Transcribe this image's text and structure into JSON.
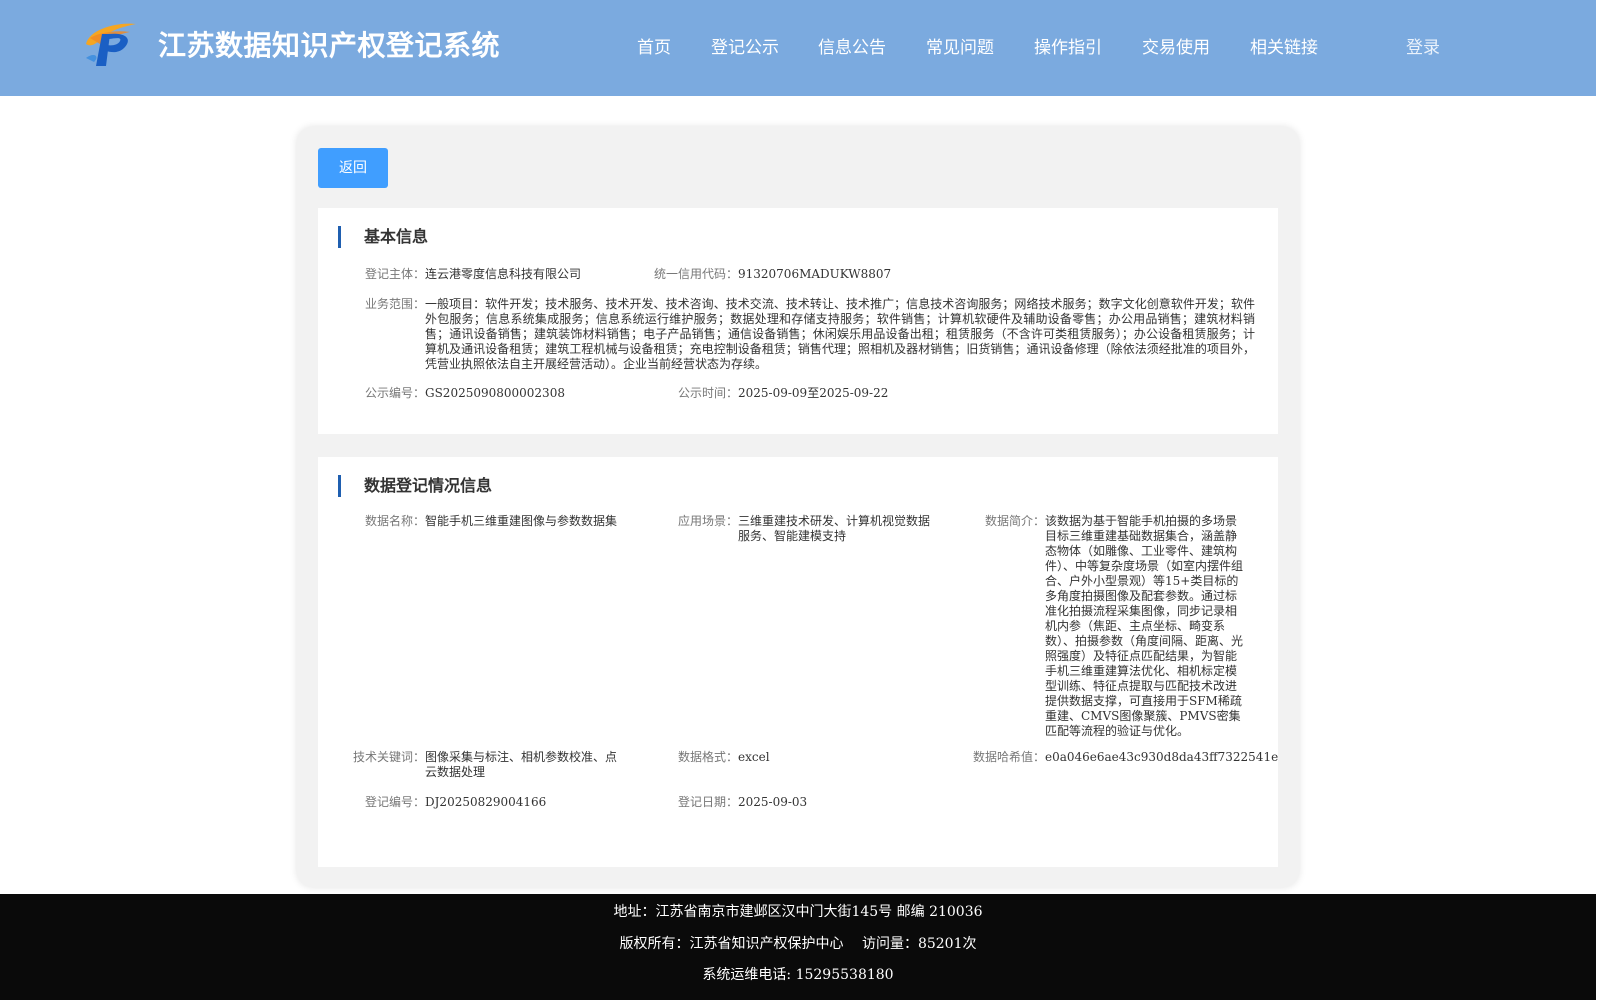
{
  "header": {
    "title": "江苏数据知识产权登记系统",
    "nav": [
      "首页",
      "登记公示",
      "信息公告",
      "常见问题",
      "操作指引",
      "交易使用",
      "相关链接"
    ],
    "login_label": "登录"
  },
  "back_label": "返回",
  "basic_info": {
    "section_title": "基本信息",
    "subject_label": "登记主体：",
    "subject_value": "连云港零度信息科技有限公司",
    "credit_code_label": "统一信用代码：",
    "credit_code_value": "91320706MADUKW8807",
    "business_scope_label": "业务范围：",
    "business_scope_value": "一般项目：软件开发；技术服务、技术开发、技术咨询、技术交流、技术转让、技术推广；信息技术咨询服务；网络技术服务；数字文化创意软件开发；软件外包服务；信息系统集成服务；信息系统运行维护服务；数据处理和存储支持服务；软件销售；计算机软硬件及辅助设备零售；办公用品销售；建筑材料销售；通讯设备销售；建筑装饰材料销售；电子产品销售；通信设备销售；休闲娱乐用品设备出租；租赁服务（不含许可类租赁服务）；办公设备租赁服务；计算机及通讯设备租赁；建筑工程机械与设备租赁；充电控制设备租赁；销售代理；照相机及器材销售；旧货销售；通讯设备修理（除依法须经批准的项目外，凭营业执照依法自主开展经营活动）。企业当前经营状态为存续。",
    "notice_no_label": "公示编号：",
    "notice_no_value": "GS2025090800002308",
    "notice_time_label": "公示时间：",
    "notice_time_value": "2025-09-09至2025-09-22"
  },
  "data_info": {
    "section_title": "数据登记情况信息",
    "name_label": "数据名称：",
    "name_value": "智能手机三维重建图像与参数数据集",
    "scenario_label": "应用场景：",
    "scenario_value": "三维重建技术研发、计算机视觉数据服务、智能建模支持",
    "intro_label": "数据简介：",
    "intro_value": "该数据为基于智能手机拍摄的多场景目标三维重建基础数据集合，涵盖静态物体（如雕像、工业零件、建筑构件）、中等复杂度场景（如室内摆件组合、户外小型景观）等15+类目标的多角度拍摄图像及配套参数。通过标准化拍摄流程采集图像，同步记录相机内参（焦距、主点坐标、畸变系数）、拍摄参数（角度间隔、距离、光照强度）及特征点匹配结果，为智能手机三维重建算法优化、相机标定模型训练、特征点提取与匹配技术改进提供数据支撑，可直接用于SFM稀疏重建、CMVS图像聚簇、PMVS密集匹配等流程的验证与优化。",
    "keywords_label": "技术关键词：",
    "keywords_value": "图像采集与标注、相机参数校准、点云数据处理",
    "format_label": "数据格式：",
    "format_value": "excel",
    "hash_label": "数据哈希值：",
    "hash_value": "e0a046e6ae43c930d8da43ff7322541e",
    "reg_no_label": "登记编号：",
    "reg_no_value": "DJ20250829004166",
    "reg_date_label": "登记日期：",
    "reg_date_value": "2025-09-03"
  },
  "footer": {
    "address": "地址：江苏省南京市建邺区汉中门大街145号 邮编 210036",
    "copyright": "版权所有：江苏省知识产权保护中心　 访问量：85201次",
    "phone": "系统运维电话: 15295538180"
  },
  "colors": {
    "header_bg": "#7baadf",
    "button_bg": "#409eff",
    "section_accent": "#1f5fb0",
    "footer_bg": "#0a0a0a"
  }
}
